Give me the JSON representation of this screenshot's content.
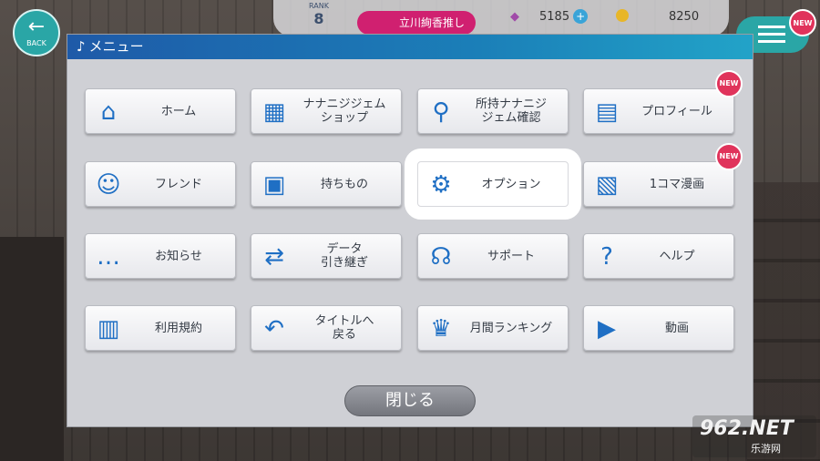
{
  "hud": {
    "back_label": "BACK",
    "rank_label": "RANK",
    "rank_value": "8",
    "oshi_label": "立川絢香推し",
    "gem_count": "5185",
    "coin_count": "8250",
    "new_badge": "NEW"
  },
  "menu": {
    "title": "メニュー",
    "items": [
      {
        "label": "ホーム",
        "icon": "home-icon"
      },
      {
        "label": "ナナニジジェム\nショップ",
        "icon": "shop-icon"
      },
      {
        "label": "所持ナナニジ\nジェム確認",
        "icon": "gem-search-icon"
      },
      {
        "label": "プロフィール",
        "icon": "profile-card-icon",
        "badge": "NEW"
      },
      {
        "label": "フレンド",
        "icon": "friends-icon"
      },
      {
        "label": "持ちもの",
        "icon": "bag-icon"
      },
      {
        "label": "オプション",
        "icon": "gear-icon",
        "highlighted": true
      },
      {
        "label": "1コマ漫画",
        "icon": "comic-icon",
        "badge": "NEW"
      },
      {
        "label": "お知らせ",
        "icon": "speech-bubble-icon"
      },
      {
        "label": "データ\n引き継ぎ",
        "icon": "data-transfer-icon"
      },
      {
        "label": "サポート",
        "icon": "headset-icon"
      },
      {
        "label": "ヘルプ",
        "icon": "help-icon"
      },
      {
        "label": "利用規約",
        "icon": "document-icon"
      },
      {
        "label": "タイトルへ\n戻る",
        "icon": "return-icon"
      },
      {
        "label": "月間ランキング",
        "icon": "crown-icon"
      },
      {
        "label": "動画",
        "icon": "video-icon"
      }
    ],
    "close_label": "閉じる"
  },
  "watermark": {
    "main": "962.NET",
    "sub": "乐游网"
  }
}
